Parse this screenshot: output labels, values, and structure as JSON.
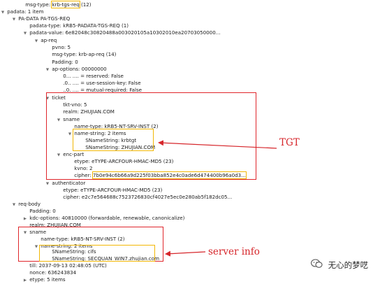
{
  "rows": {
    "r00": {
      "pre": "msg-type:",
      "hl": "krb-tgs-req",
      "post": "(12)"
    },
    "r01": {
      "text": "padata: 1 item"
    },
    "r02": {
      "text": "PA-DATA PA-TGS-REQ"
    },
    "r03": {
      "text": "padata-type: kRB5-PADATA-TGS-REQ (1)"
    },
    "r04": {
      "text": "padata-value: 6e82048c30820488a003020105a10302010ea20703050000..."
    },
    "r05": {
      "text": "ap-req"
    },
    "r06": {
      "text": "pvno: 5"
    },
    "r07": {
      "text": "msg-type: krb-ap-req (14)"
    },
    "r08": {
      "text": "Padding: 0"
    },
    "r09": {
      "text": "ap-options: 00000000"
    },
    "r10": {
      "text": "0... .... = reserved: False"
    },
    "r11": {
      "text": ".0.. .... = use-session-key: False"
    },
    "r12": {
      "text": "..0. .... = mutual-required: False"
    },
    "r13": {
      "text": "ticket"
    },
    "r14": {
      "text": "tkt-vno: 5"
    },
    "r15": {
      "text": "realm: ZHUJIAN.COM"
    },
    "r16": {
      "text": "sname"
    },
    "r17": {
      "text": "name-type: kRB5-NT-SRV-INST (2)"
    },
    "r18": {
      "text": "name-string: 2 items"
    },
    "r19": {
      "text": "SNameString: krbtgt"
    },
    "r20": {
      "text": "SNameString: ZHUJIAN.COM"
    },
    "r21": {
      "text": "enc-part"
    },
    "r22": {
      "text": "etype: eTYPE-ARCFOUR-HMAC-MD5 (23)"
    },
    "r23": {
      "text": "kvno: 2"
    },
    "r24": {
      "pre": "cipher:",
      "hl": "7b0e94c6b66a9d225f03bba852e4c0ade6d474400b96a0d3..."
    },
    "r25": {
      "text": "authenticator"
    },
    "r26": {
      "text": "etype: eTYPE-ARCFOUR-HMAC-MD5 (23)"
    },
    "r27": {
      "text": "cipher: e2c7e564688c7523726830cf4027e5ec0e280ab5f182dc05..."
    },
    "r28": {
      "text": "req-body"
    },
    "r29": {
      "text": "Padding: 0"
    },
    "r30": {
      "text": "kdc-options: 40810000 (forwardable, renewable, canonicalize)"
    },
    "r31": {
      "text": "realm: ZHUJIAN.COM"
    },
    "r32": {
      "text": "sname"
    },
    "r33": {
      "text": "name-type: kRB5-NT-SRV-INST (2)"
    },
    "r34": {
      "text": "name-string: 2 items"
    },
    "r35": {
      "text": "SNameString: cifs"
    },
    "r36": {
      "text": "SNameString: SECQUAN_WIN7.zhujian.com"
    },
    "r37": {
      "text": "till: 2037-09-13 02:48:05 (UTC)"
    },
    "r38": {
      "text": "nonce: 636243834"
    },
    "r39": {
      "text": "etype: 5 items"
    }
  },
  "annotations": {
    "tgt": "TGT",
    "server_info": "server info"
  },
  "watermark": {
    "text": "无心的梦呓"
  },
  "colors": {
    "box_red": "#e0262b",
    "box_yellow": "#f2b705",
    "annotation": "#d6262b"
  },
  "icons": {
    "expanded": "triangle-down-icon",
    "collapsed": "triangle-right-icon",
    "watermark": "wechat-logo-icon"
  }
}
